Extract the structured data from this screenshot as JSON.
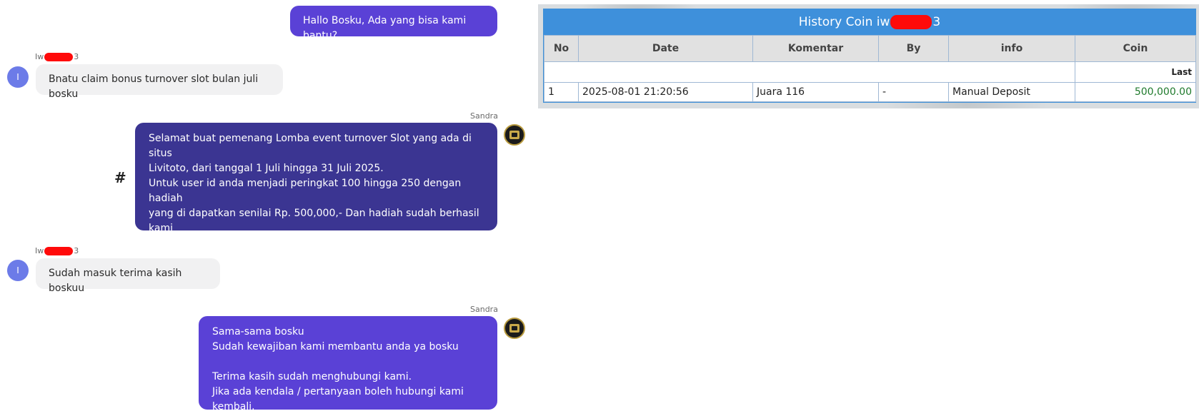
{
  "chat": {
    "messages": [
      {
        "role": "agent",
        "text": "Hallo Bosku, Ada yang bisa kami bantu?"
      },
      {
        "role": "user",
        "sender_prefix": "Iw",
        "sender_suffix": "3",
        "avatar": "I",
        "text": "Bnatu claim bonus turnover slot bulan juli bosku"
      },
      {
        "role": "agent",
        "sender": "Sandra",
        "text": "Selamat buat pemenang Lomba event turnover Slot yang ada di situs\nLivitoto, dari tanggal 1 Juli hingga 31 Juli 2025.\nUntuk user id anda menjadi peringkat 100 hingga 250 dengan hadiah\nyang di dapatkan senilai Rp. 500,000,- Dan hadiah sudah berhasil kami\nberikan melalui saldo akun anda ya bosku, Terima kasih atas\npartisipasinya, dan sampai jumpa di event selanjutnya, ya bosku"
      },
      {
        "role": "user",
        "sender_prefix": "Iw",
        "sender_suffix": "3",
        "avatar": "I",
        "text": "Sudah masuk terima kasih boskuu"
      },
      {
        "role": "agent",
        "sender": "Sandra",
        "text": "Sama-sama bosku\nSudah kewajiban kami membantu anda ya bosku\n\nTerima kasih sudah menghubungi kami.\nJika ada kendala / pertanyaan boleh hubungi kami kembali."
      }
    ],
    "hash_symbol": "#",
    "colors": {
      "agent_bubble": "#5a41d6",
      "agent_bubble_dark": "#3b3592",
      "user_bubble": "#f1f1f2"
    }
  },
  "history": {
    "title_prefix": "History Coin iw",
    "title_suffix": "3",
    "columns": [
      "No",
      "Date",
      "Komentar",
      "By",
      "info",
      "Coin"
    ],
    "last_label": "Last",
    "rows": [
      {
        "no": "1",
        "date": "2025-08-01 21:20:56",
        "komentar": "Juara 116",
        "by": "-",
        "info": "Manual Deposit",
        "coin": "500,000.00"
      }
    ],
    "colors": {
      "header": "#3e90db",
      "coin": "#1f7a2c"
    }
  }
}
